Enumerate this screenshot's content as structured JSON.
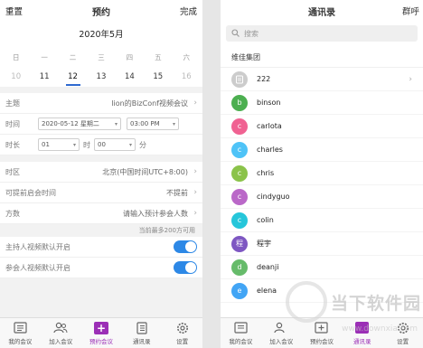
{
  "left": {
    "header": {
      "reset": "重置",
      "title": "预约",
      "done": "完成"
    },
    "calendar": {
      "month": "2020年5月",
      "weekdays": [
        "日",
        "一",
        "二",
        "三",
        "四",
        "五",
        "六"
      ],
      "dates": [
        "10",
        "11",
        "12",
        "13",
        "14",
        "15",
        "16"
      ],
      "selected": "12"
    },
    "form": {
      "subject_label": "主题",
      "subject_value": "lion的BizConf视频会议",
      "time_label": "时间",
      "date_value": "2020-05-12 星期二",
      "time_value": "03:00 PM",
      "duration_label": "时长",
      "hours_value": "01",
      "hours_unit": "时",
      "minutes_value": "00",
      "minutes_unit": "分",
      "timezone_label": "时区",
      "timezone_value": "北京(中国时间UTC+8:00)",
      "remind_label": "可提前启会时间",
      "remind_value": "不提前",
      "participants_label": "方数",
      "participants_placeholder": "请输入预计参会人数",
      "participants_hint": "当前最多200方可用",
      "host_video_label": "主持人视频默认开启",
      "attendee_video_label": "参会人视频默认开启"
    },
    "tabs": [
      {
        "label": "我的会议",
        "icon": "meeting-list-icon"
      },
      {
        "label": "加入会议",
        "icon": "join-people-icon"
      },
      {
        "label": "预约会议",
        "icon": "schedule-plus-icon",
        "active": true
      },
      {
        "label": "通讯录",
        "icon": "contacts-book-icon"
      },
      {
        "label": "设置",
        "icon": "settings-gear-icon"
      }
    ]
  },
  "right": {
    "header": {
      "title": "通讯录",
      "group_btn": "群呼"
    },
    "search_placeholder": "搜索",
    "group_name": "维佳集团",
    "contacts": [
      {
        "letter": "",
        "name": "222",
        "color": "#cccccc"
      },
      {
        "letter": "b",
        "name": "binson",
        "color": "#4caf50"
      },
      {
        "letter": "c",
        "name": "carlota",
        "color": "#f06292"
      },
      {
        "letter": "c",
        "name": "charles",
        "color": "#4fc3f7"
      },
      {
        "letter": "c",
        "name": "chris",
        "color": "#8bc34a"
      },
      {
        "letter": "c",
        "name": "cindyguo",
        "color": "#ba68c8"
      },
      {
        "letter": "c",
        "name": "colin",
        "color": "#26c6da"
      },
      {
        "letter": "程",
        "name": "程宇",
        "color": "#7e57c2"
      },
      {
        "letter": "d",
        "name": "deanji",
        "color": "#66bb6a"
      },
      {
        "letter": "e",
        "name": "elena",
        "color": "#42a5f5"
      }
    ],
    "tabs": [
      {
        "label": "我的会议"
      },
      {
        "label": "加入会议"
      },
      {
        "label": "预约会议"
      },
      {
        "label": "通讯录",
        "active": true
      },
      {
        "label": "设置"
      }
    ]
  },
  "watermark": {
    "text": "当下软件园",
    "url": "www.downxia.com"
  }
}
